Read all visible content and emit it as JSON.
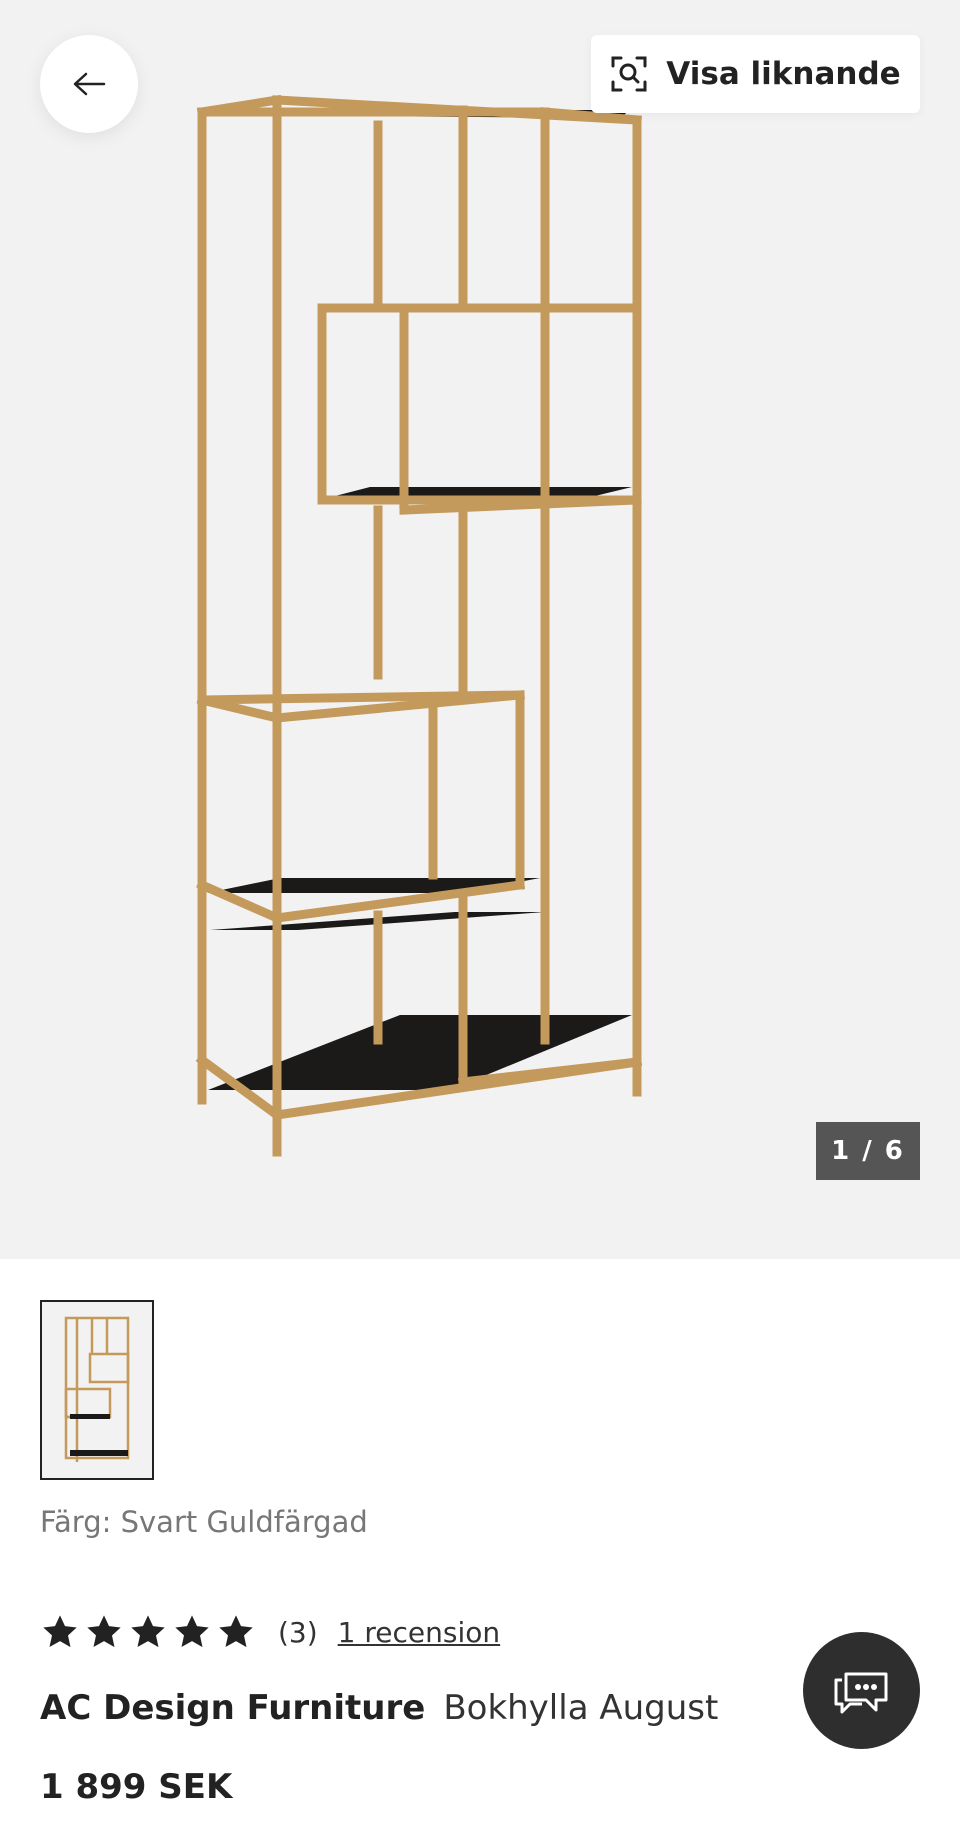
{
  "top_bar": {
    "back_icon": "arrow-left-icon",
    "similar_icon": "visual-search-icon",
    "similar_label": "Visa liknande"
  },
  "gallery": {
    "counter": "1 / 6",
    "current": 1,
    "total": 6,
    "colors": {
      "background": "#f3f2f2",
      "frame": "#c49a5c",
      "shelf": "#1c1a19"
    }
  },
  "product": {
    "color_label": "Färg: Svart Guldfärgad",
    "rating": 5,
    "rating_count": "(3)",
    "review_link": "1 recension",
    "brand": "AC Design Furniture",
    "name": "Bokhylla August",
    "price": "1 899 SEK"
  },
  "chat": {
    "icon": "chat-bubbles-icon"
  }
}
